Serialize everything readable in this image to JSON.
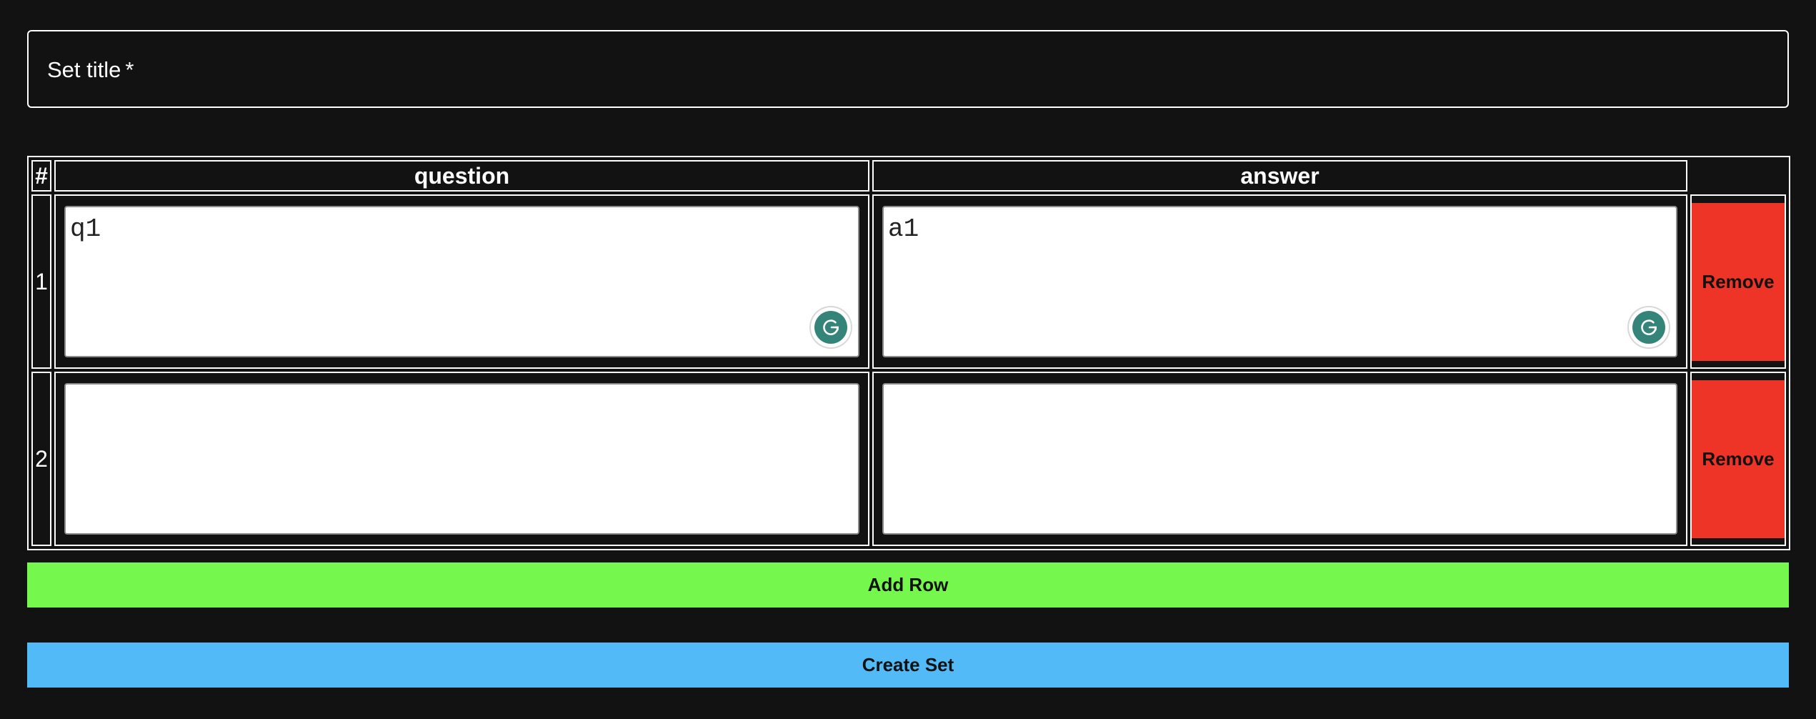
{
  "form": {
    "title_label": "Set title",
    "required_marker": "*",
    "title_value": ""
  },
  "table": {
    "headers": {
      "num": "#",
      "question": "question",
      "answer": "answer"
    },
    "rows": [
      {
        "num": "1",
        "question": "q1",
        "answer": "a1",
        "remove_label": "Remove"
      },
      {
        "num": "2",
        "question": "",
        "answer": "",
        "remove_label": "Remove"
      }
    ]
  },
  "buttons": {
    "add_row": "Add Row",
    "create_set": "Create Set"
  },
  "colors": {
    "background": "#121212",
    "remove": "#ee3327",
    "add_row": "#75f74e",
    "create_set": "#52bbf7",
    "grammarly": "#35847a"
  },
  "icons": {
    "grammarly": "grammarly-icon"
  }
}
